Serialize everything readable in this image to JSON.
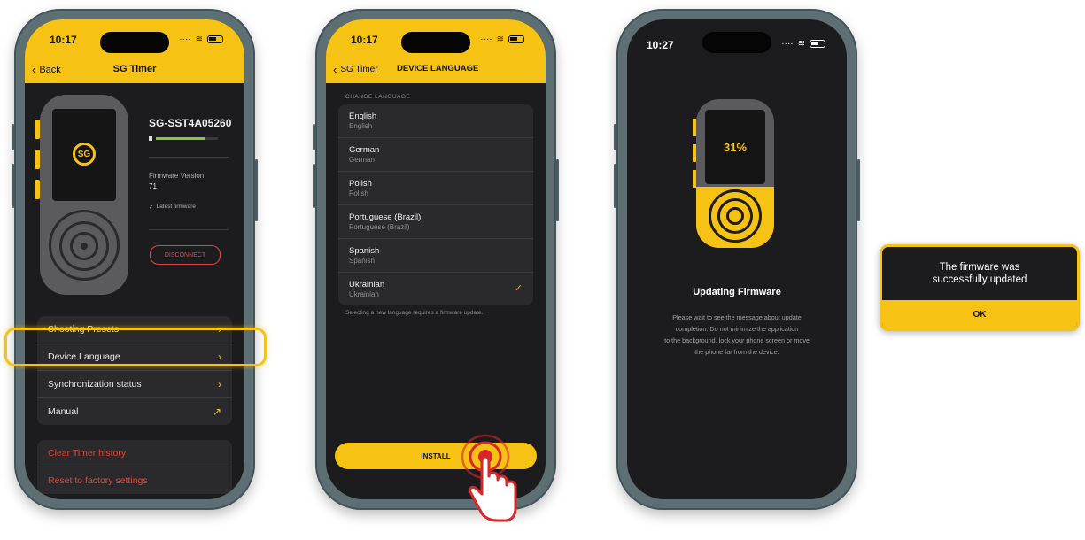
{
  "phone1": {
    "time": "10:17",
    "back_label": "Back",
    "title": "SG Timer",
    "device_name": "SG-SST4A05260",
    "battery_level": 0.8,
    "firmware_label": "Firmware Version:",
    "firmware_value": "71",
    "latest_label": "Latest firmware",
    "disconnect_label": "DISCONNECT",
    "logo_text": "SG",
    "menu": [
      {
        "label": "Shooting Presets",
        "icon": "chevron-right-icon"
      },
      {
        "label": "Device Language",
        "icon": "chevron-right-icon"
      },
      {
        "label": "Synchronization status",
        "icon": "chevron-right-icon"
      },
      {
        "label": "Manual",
        "icon": "arrow-up-right-icon"
      }
    ],
    "danger": [
      {
        "label": "Clear Timer history"
      },
      {
        "label": "Reset to factory settings"
      }
    ]
  },
  "phone2": {
    "time": "10:17",
    "back_label": "SG Timer",
    "title": "DEVICE LANGUAGE",
    "section_label": "CHANGE LANGUAGE",
    "languages": [
      {
        "name": "English",
        "native": "English"
      },
      {
        "name": "German",
        "native": "German"
      },
      {
        "name": "Polish",
        "native": "Polish"
      },
      {
        "name": "Portuguese (Brazil)",
        "native": "Portuguese (Brazil)"
      },
      {
        "name": "Spanish",
        "native": "Spanish"
      },
      {
        "name": "Ukrainian",
        "native": "Ukrainian",
        "selected": true
      }
    ],
    "note": "Selecting a new language requires a firmware update.",
    "install_label": "INSTALL"
  },
  "phone3": {
    "time": "10:27",
    "progress_text": "31%",
    "progress": 0.31,
    "heading": "Updating Firmware",
    "message_lines": [
      "Please wait to see the message about update",
      "completion. Do not minimize the application",
      "to the background, lock your phone screen or move",
      "the phone far from the device."
    ]
  },
  "dialog": {
    "line1": "The firmware was",
    "line2": "successfully updated",
    "ok_label": "OK"
  },
  "colors": {
    "accent": "#f6c214",
    "background": "#1c1c1e",
    "danger": "#e0443b",
    "highlight": "#f6c214",
    "tap": "#d8262b"
  }
}
